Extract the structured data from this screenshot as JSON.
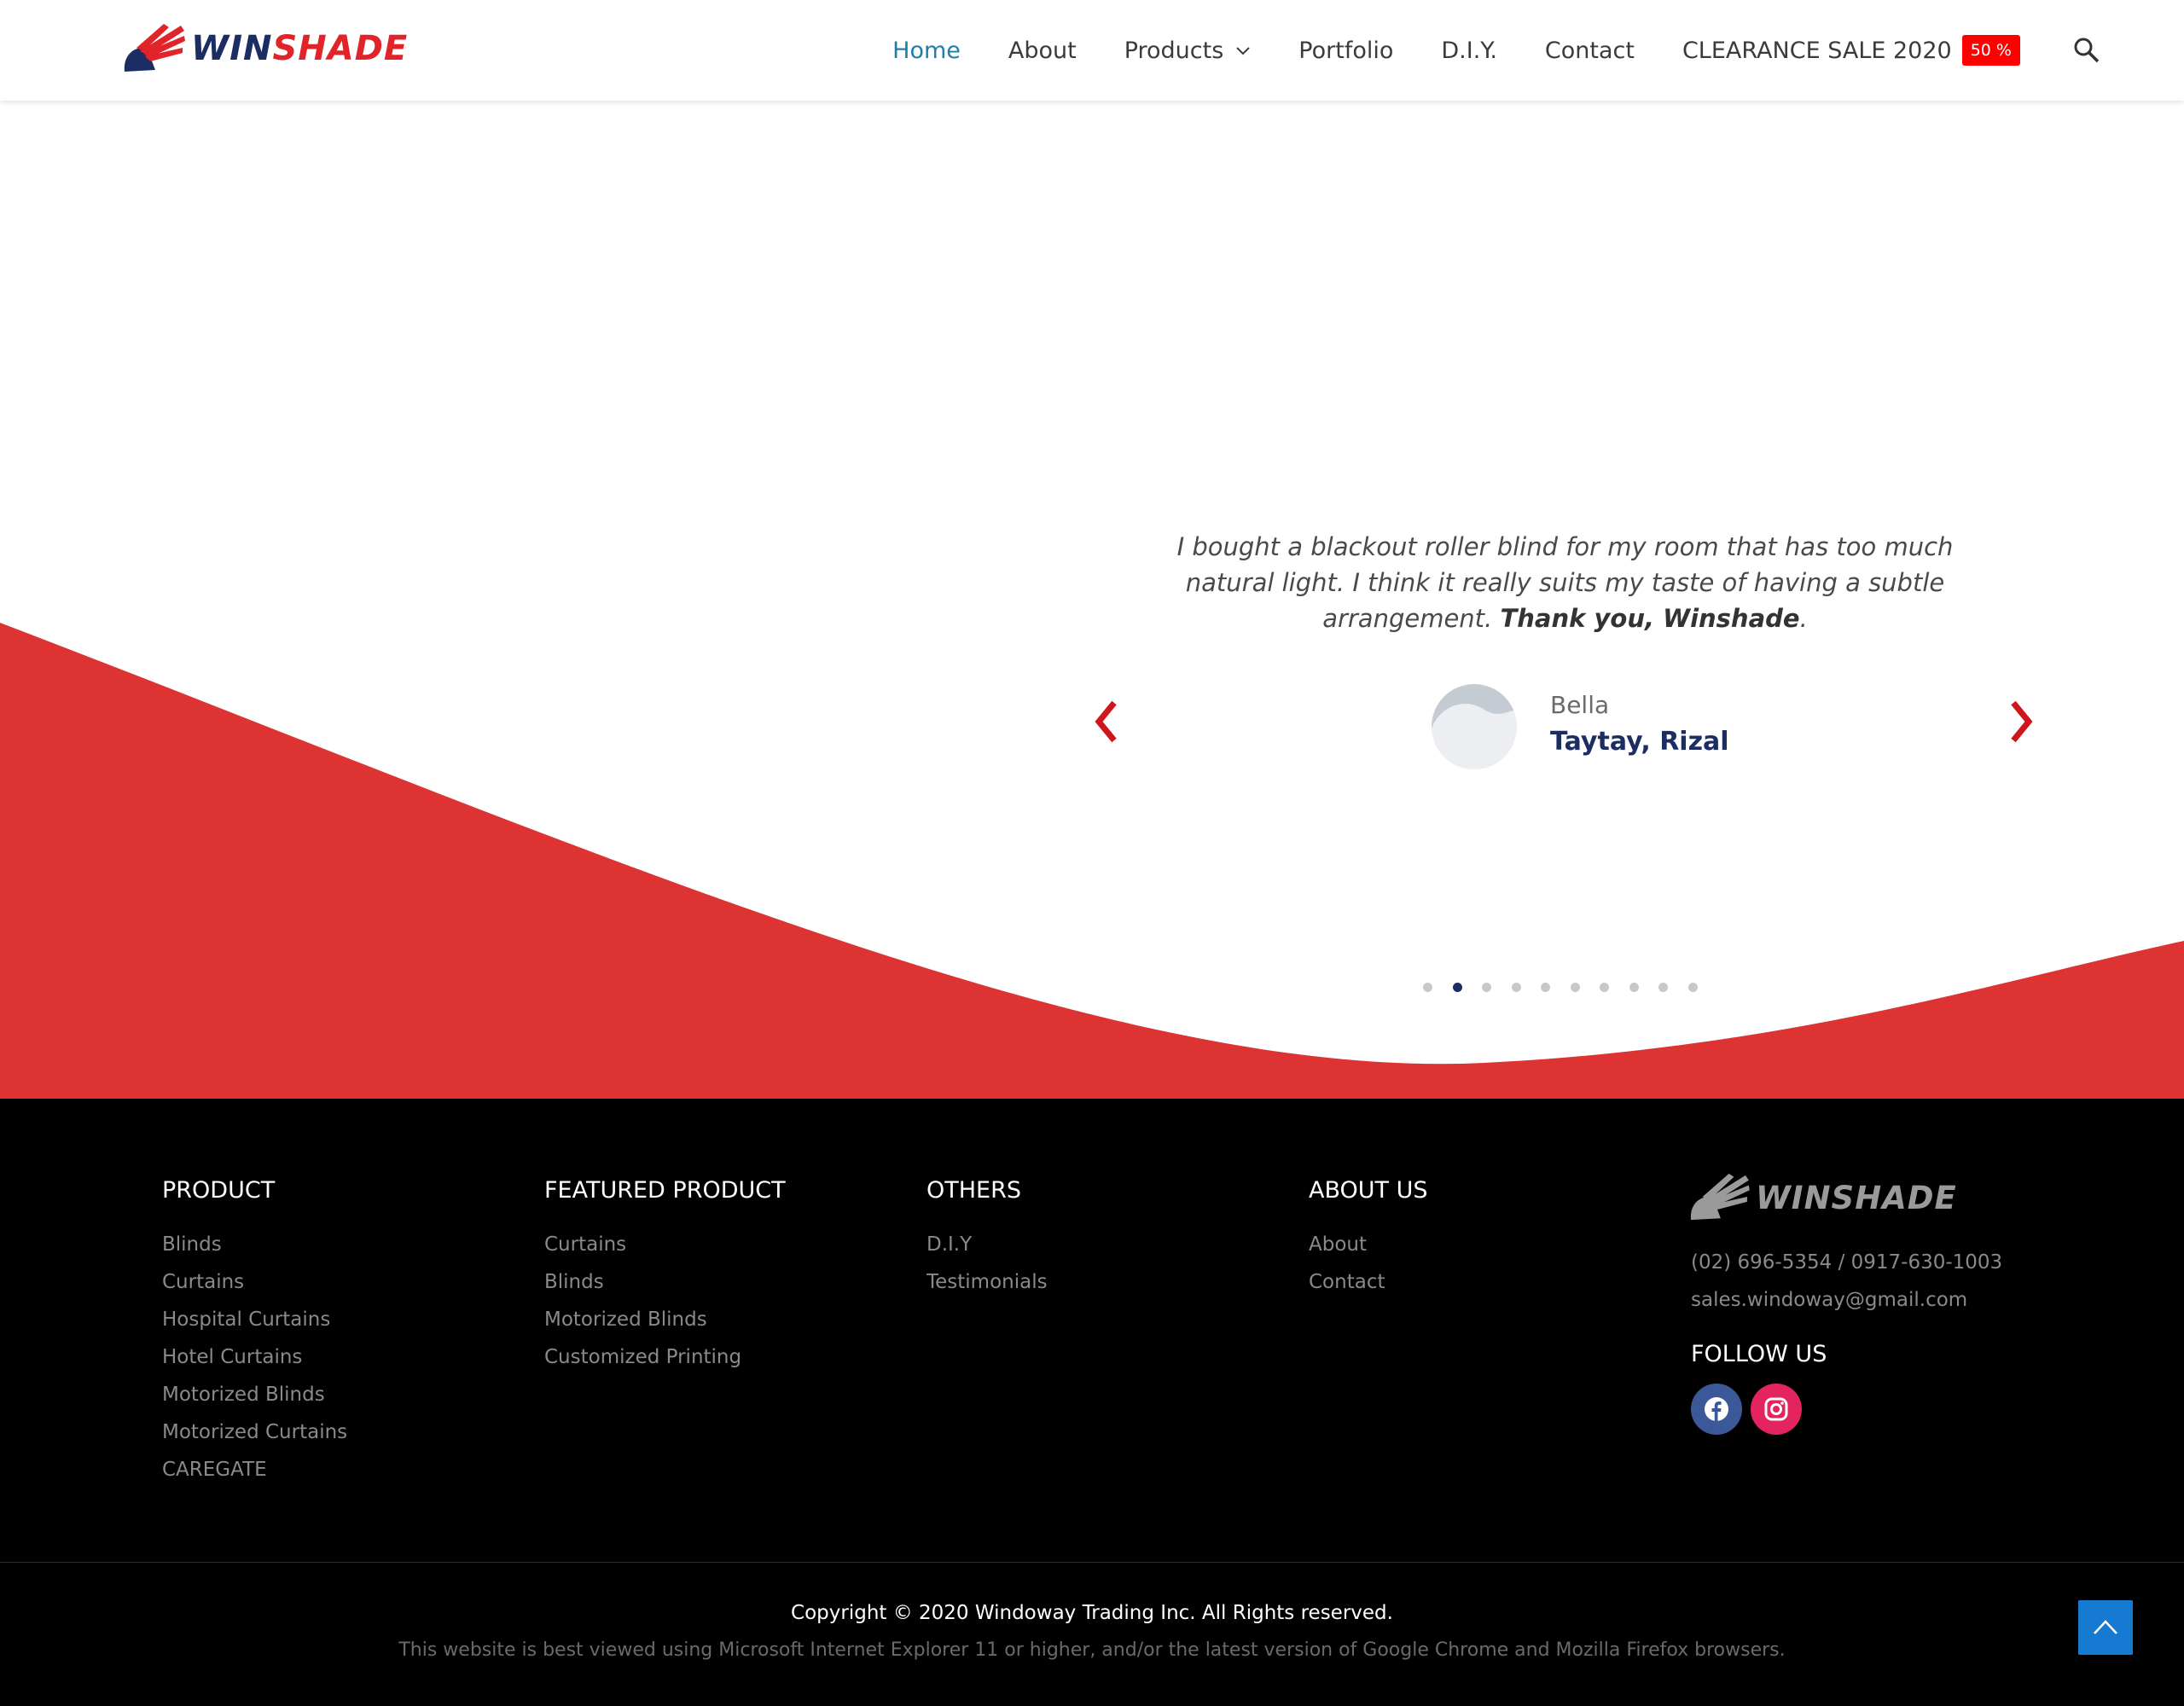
{
  "brand": {
    "name_part1": "WIN",
    "name_part2": "SHADE",
    "accent_red": "#e0242a",
    "navy": "#1b2d63"
  },
  "nav": {
    "items": [
      "Home",
      "About",
      "Products",
      "Portfolio",
      "D.I.Y.",
      "Contact",
      "CLEARANCE SALE 2020"
    ],
    "active": "Home",
    "sale_badge": "50 %"
  },
  "testimonial": {
    "quote_text": "I bought a blackout roller blind for my room that has too much natural light. I think it really suits my taste of having a subtle arrangement. ",
    "quote_bold": "Thank you, Winshade",
    "quote_end": ".",
    "name": "Bella",
    "location": "Taytay, Rizal",
    "slide_count": 10,
    "active_slide": 2
  },
  "wave_color": "#dd3333",
  "footer": {
    "product": {
      "title": "PRODUCT",
      "links": [
        "Blinds",
        "Curtains",
        "Hospital Curtains",
        "Hotel Curtains",
        "Motorized Blinds",
        "Motorized Curtains",
        "CAREGATE"
      ]
    },
    "featured": {
      "title": "FEATURED PRODUCT",
      "links": [
        "Curtains",
        "Blinds",
        "Motorized Blinds",
        "Customized Printing"
      ]
    },
    "others": {
      "title": "OTHERS",
      "links": [
        "D.I.Y",
        "Testimonials"
      ]
    },
    "about": {
      "title": "ABOUT US",
      "links": [
        "About",
        "Contact"
      ]
    },
    "phone": "(02) 696-5354 / 0917-630-1003",
    "email": "sales.windoway@gmail.com",
    "follow_title": "FOLLOW US",
    "copyright": "Copyright © 2020 Windoway Trading Inc. All Rights reserved.",
    "browsers_note": "This website is best viewed using Microsoft Internet Explorer 11 or higher, and/or the latest version of Google Chrome and Mozilla Firefox browsers."
  },
  "icons": {
    "search": "search-icon",
    "chevron": "chevron-down-icon",
    "prev": "chevron-left-icon",
    "next": "chevron-right-icon",
    "facebook": "facebook-icon",
    "instagram": "instagram-icon",
    "top": "arrow-up-icon"
  }
}
